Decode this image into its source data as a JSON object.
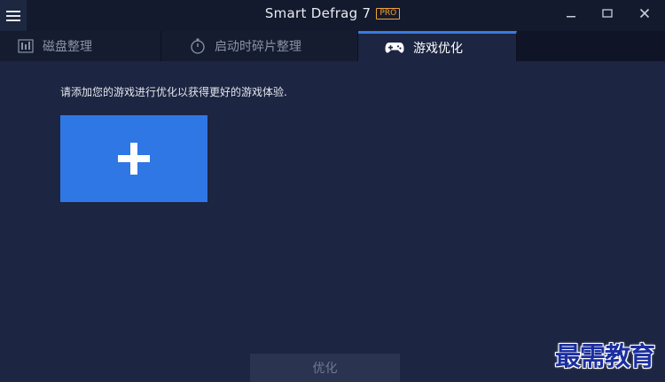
{
  "window": {
    "title": "Smart Defrag 7",
    "badge": "PRO"
  },
  "tabs": [
    {
      "label": "磁盘整理",
      "icon": "disk-defrag-icon",
      "active": false
    },
    {
      "label": "启动时碎片整理",
      "icon": "stopwatch-icon",
      "active": false
    },
    {
      "label": "游戏优化",
      "icon": "gamepad-icon",
      "active": true
    }
  ],
  "main": {
    "instruction": "请添加您的游戏进行优化以获得更好的游戏体验.",
    "optimize_label": "优化"
  },
  "watermark": {
    "text": "最需教育"
  },
  "colors": {
    "background": "#1c2541",
    "accent": "#2f77e4",
    "pro_badge": "#f0a23a"
  }
}
